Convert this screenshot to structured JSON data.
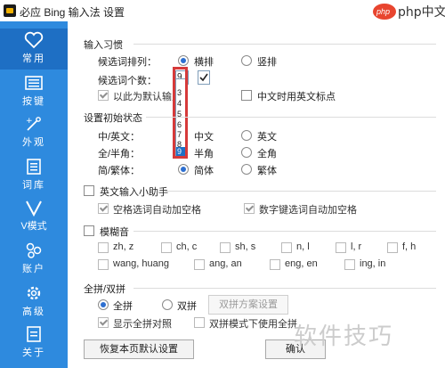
{
  "window": {
    "title": "必应 Bing 输入法 设置"
  },
  "watermark": {
    "top": "php中文网",
    "bottom": "软件技巧"
  },
  "sidebar": {
    "items": [
      {
        "label": "常用",
        "icon": "heart-icon"
      },
      {
        "label": "按键",
        "icon": "keyboard-icon"
      },
      {
        "label": "外观",
        "icon": "palette-icon"
      },
      {
        "label": "词库",
        "icon": "book-icon"
      },
      {
        "label": "V模式",
        "icon": "v-icon"
      },
      {
        "label": "账户",
        "icon": "account-icon"
      },
      {
        "label": "高级",
        "icon": "gear-icon"
      },
      {
        "label": "关于",
        "icon": "info-doc-icon"
      }
    ]
  },
  "input_habits": {
    "title": "输入习惯",
    "arrangement_label": "候选词排列：",
    "horizontal": "横排",
    "vertical": "竖排",
    "count_label": "候选词个数：",
    "count_value": "9",
    "dropdown_options": [
      "3",
      "4",
      "5",
      "6",
      "7",
      "8",
      "9"
    ],
    "default_ime": "以此为默认输入",
    "chinese_english_punct": "中文时用英文标点"
  },
  "initial_state": {
    "title": "设置初始状态",
    "row1_label": "中/英文：",
    "row1_a": "中文",
    "row1_b": "英文",
    "row2_label": "全/半角：",
    "row2_a": "半角",
    "row2_b": "全角",
    "row3_label": "简/繁体：",
    "row3_a": "简体",
    "row3_b": "繁体"
  },
  "english_helper": {
    "title": "英文输入小助手",
    "opt1": "空格选词自动加空格",
    "opt2": "数字键选词自动加空格"
  },
  "fuzzy": {
    "title": "模糊音",
    "row1": [
      "zh, z",
      "ch, c",
      "sh, s",
      "n, l",
      "l, r",
      "f, h"
    ],
    "row2": [
      "wang, huang",
      "ang, an",
      "eng, en",
      "ing, in"
    ]
  },
  "pinyin": {
    "title": "全拼/双拼",
    "full": "全拼",
    "double": "双拼",
    "scheme_button": "双拼方案设置",
    "show_full_pinyin": "显示全拼对照",
    "use_full_in_double": "双拼模式下使用全拼"
  },
  "footer": {
    "restore_button": "恢复本页默认设置",
    "ok_button": "确认"
  }
}
